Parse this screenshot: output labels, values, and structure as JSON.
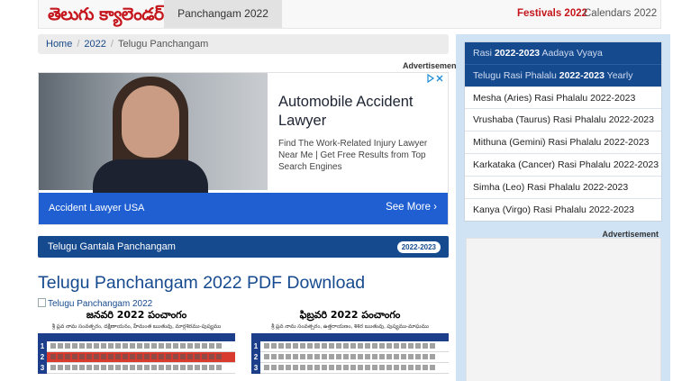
{
  "navbar": {
    "brand": "తెలుగు క్యాలెండర్",
    "active_tab": "Panchangam 2022",
    "festivals": "Festivals 2022",
    "calendars": "Calendars 2022"
  },
  "breadcrumb": {
    "home": "Home",
    "year": "2022",
    "current": "Telugu Panchangam"
  },
  "ad": {
    "label": "Advertisement",
    "title": "Automobile Accident Lawyer",
    "description": "Find The Work-Related Injury Lawyer Near Me | Get Free Results from Top Search Engines",
    "sponsor": "Accident Lawyer USA",
    "cta": "See More ›"
  },
  "gantala": {
    "label": "Telugu Gantala Panchangam",
    "badge": "2022-2023"
  },
  "main": {
    "title": "Telugu Panchangam 2022 PDF Download",
    "image_alt": "Telugu Panchangam 2022"
  },
  "calendar_preview": [
    {
      "heading": "జనవరి 2022 పంచాంగం",
      "subtitle": "శ్రీ ప్లవ నామ సంవత్సరం, దక్షిణాయనం, హేమంత ఋతువు, మార్గశిరము-పుష్యము",
      "days": [
        "1",
        "2",
        "3"
      ]
    },
    {
      "heading": "ఫిబ్రవరి 2022 పంచాంగం",
      "subtitle": "శ్రీ ప్లవ నామ సంవత్సరం, ఉత్తరాయణం, శిశిర ఋతువు, పుష్యము-మాఘము",
      "days": [
        "1",
        "2",
        "3"
      ]
    }
  ],
  "sidebar": {
    "items": [
      {
        "prefix": "Rasi ",
        "year": "2022-2023",
        "suffix": " Aadaya Vyaya"
      },
      {
        "prefix": "Telugu Rasi Phalalu ",
        "year": "2022-2023",
        "suffix": " Yearly"
      },
      {
        "label": "Mesha (Aries) Rasi Phalalu 2022-2023"
      },
      {
        "label": "Vrushaba (Taurus) Rasi Phalalu 2022-2023"
      },
      {
        "label": "Mithuna (Gemini) Rasi Phalalu 2022-2023"
      },
      {
        "label": "Karkataka (Cancer) Rasi Phalalu 2022-2023"
      },
      {
        "label": "Simha (Leo) Rasi Phalalu 2022-2023"
      },
      {
        "label": "Kanya (Virgo) Rasi Phalalu 2022-2023"
      }
    ],
    "ad_label": "Advertisement"
  },
  "colors": {
    "brand_red": "#c4161c",
    "primary_blue": "#164a8f",
    "ad_blue": "#1f5fd2",
    "sidebar_bg": "#cfe3f5"
  }
}
